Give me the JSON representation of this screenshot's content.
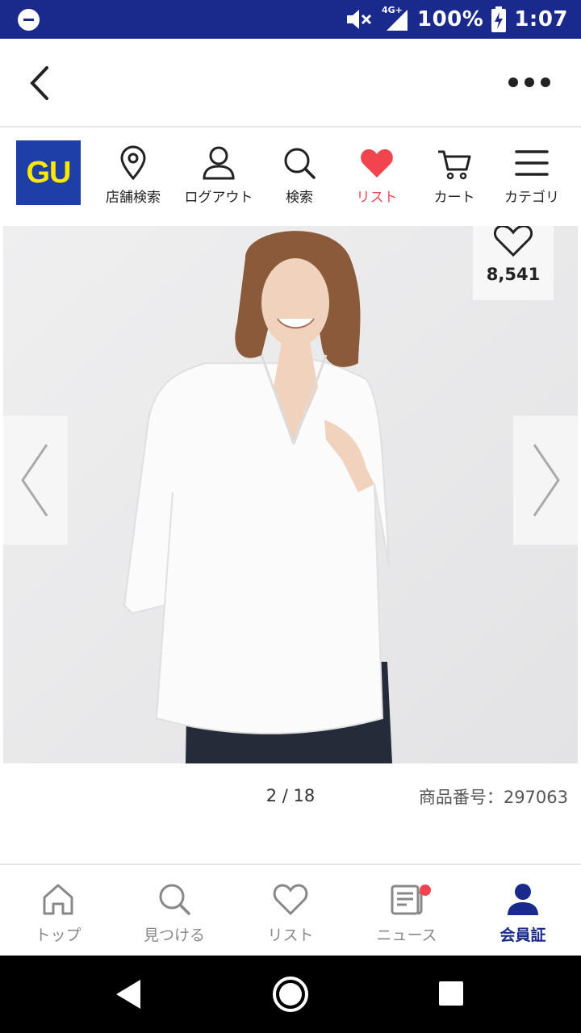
{
  "status_bar": {
    "network": "4G+",
    "battery": "100%",
    "time": "1:07"
  },
  "header": {
    "back_icon": "chevron-left-icon",
    "more_icon": "more-dots-icon"
  },
  "brand": {
    "logo_text": "GU",
    "logo_bg": "#1f3fa8",
    "logo_fg": "#ffe900"
  },
  "top_nav": {
    "items": [
      {
        "label": "店舗検索",
        "icon": "location-pin-icon"
      },
      {
        "label": "ログアウト",
        "icon": "person-icon"
      },
      {
        "label": "検索",
        "icon": "search-icon"
      },
      {
        "label": "リスト",
        "icon": "heart-icon",
        "active": true
      },
      {
        "label": "カート",
        "icon": "cart-icon"
      },
      {
        "label": "カテゴリ",
        "icon": "menu-icon"
      }
    ],
    "active_color": "#e84b57"
  },
  "product": {
    "favorite_count": "8,541",
    "page_indicator": "2 / 18",
    "product_number": "商品番号：297063"
  },
  "bottom_nav": {
    "items": [
      {
        "label": "トップ",
        "icon": "home-icon"
      },
      {
        "label": "見つける",
        "icon": "search-icon"
      },
      {
        "label": "リスト",
        "icon": "heart-outline-icon"
      },
      {
        "label": "ニュース",
        "icon": "news-icon",
        "badge": true
      },
      {
        "label": "会員証",
        "icon": "member-icon",
        "active": true
      }
    ],
    "active_color": "#1a2a8c"
  }
}
